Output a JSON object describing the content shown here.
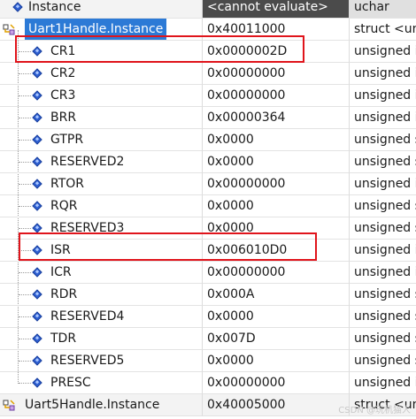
{
  "header": {
    "name": "Instance",
    "value": "<cannot evaluate>",
    "type": "uchar"
  },
  "parent": {
    "name": "Uart1Handle.Instance",
    "value": "0x40011000",
    "type": "struct <unt"
  },
  "children": [
    {
      "name": "CR1",
      "value": "0x0000002D",
      "type": "unsigned in"
    },
    {
      "name": "CR2",
      "value": "0x00000000",
      "type": "unsigned in"
    },
    {
      "name": "CR3",
      "value": "0x00000000",
      "type": "unsigned in"
    },
    {
      "name": "BRR",
      "value": "0x00000364",
      "type": "unsigned in"
    },
    {
      "name": "GTPR",
      "value": "0x0000",
      "type": "unsigned s"
    },
    {
      "name": "RESERVED2",
      "value": "0x0000",
      "type": "unsigned s"
    },
    {
      "name": "RTOR",
      "value": "0x00000000",
      "type": "unsigned in"
    },
    {
      "name": "RQR",
      "value": "0x0000",
      "type": "unsigned s"
    },
    {
      "name": "RESERVED3",
      "value": "0x0000",
      "type": "unsigned s"
    },
    {
      "name": "ISR",
      "value": "0x006010D0",
      "type": "unsigned in"
    },
    {
      "name": "ICR",
      "value": "0x00000000",
      "type": "unsigned in"
    },
    {
      "name": "RDR",
      "value": "0x000A",
      "type": "unsigned s"
    },
    {
      "name": "RESERVED4",
      "value": "0x0000",
      "type": "unsigned s"
    },
    {
      "name": "TDR",
      "value": "0x007D",
      "type": "unsigned s"
    },
    {
      "name": "RESERVED5",
      "value": "0x0000",
      "type": "unsigned s"
    },
    {
      "name": "PRESC",
      "value": "0x00000000",
      "type": "unsigned in"
    }
  ],
  "last": {
    "name": "Uart5Handle.Instance",
    "value": "0x40005000",
    "type": "struct <unt"
  },
  "watermark": "CSDN @玩机猫人",
  "colors": {
    "selection": "#2c7ad6",
    "highlight_box": "#e0141b",
    "member_icon": "#2e5fd1"
  },
  "icons": {
    "member": "blue-diamond-icon",
    "struct": "struct-node-icon"
  }
}
